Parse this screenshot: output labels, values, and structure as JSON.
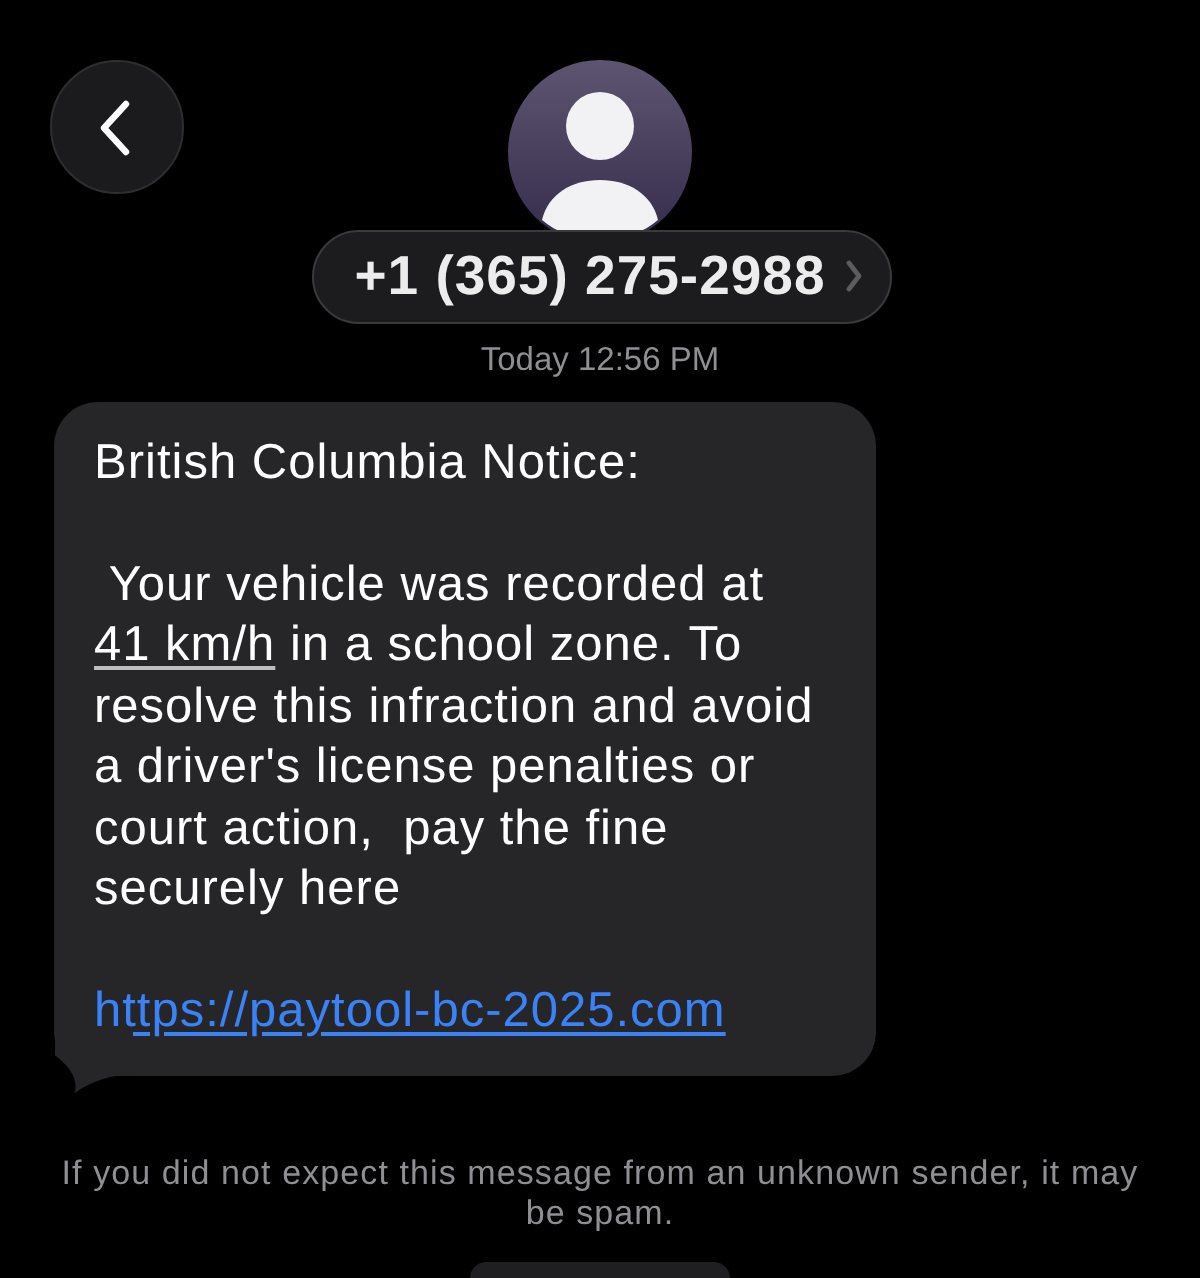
{
  "contact": {
    "phone_number": "+1 (365) 275-2988"
  },
  "timestamp": "Today 12:56 PM",
  "message": {
    "paragraphs": [
      {
        "segments": [
          {
            "kind": "text",
            "text": "British Columbia Notice:"
          }
        ]
      },
      {
        "segments": [
          {
            "kind": "text",
            "text": " Your vehicle was recorded at "
          },
          {
            "kind": "detected_link",
            "text": "41 km/h"
          },
          {
            "kind": "text",
            "text": " in a school zone. To resolve this infraction and avoid a driver's license penalties or court action,  pay the fine securely here"
          }
        ]
      },
      {
        "segments": [
          {
            "kind": "url",
            "text": "https://paytool-bc-2025.com"
          }
        ]
      }
    ]
  },
  "spam_notice": "If you did not expect this message from an unknown sender, it may be spam."
}
